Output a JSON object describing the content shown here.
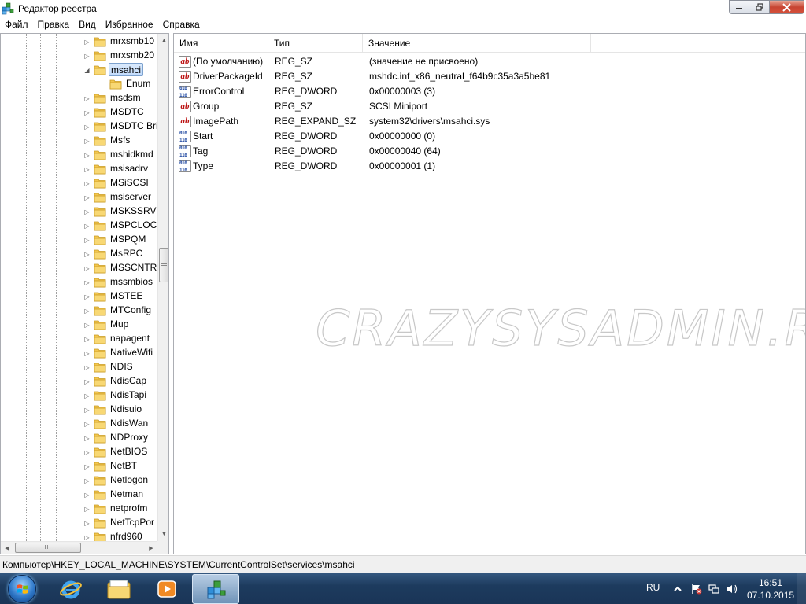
{
  "window": {
    "title": "Редактор реестра"
  },
  "menu": [
    "Файл",
    "Правка",
    "Вид",
    "Избранное",
    "Справка"
  ],
  "tree": {
    "items": [
      {
        "label": "mrxsmb10",
        "expander": "▷"
      },
      {
        "label": "mrxsmb20",
        "expander": "▷"
      },
      {
        "label": "msahci",
        "expander": "◢",
        "selected": true
      },
      {
        "label": "Enum",
        "expander": "",
        "child": true
      },
      {
        "label": "msdsm",
        "expander": "▷"
      },
      {
        "label": "MSDTC",
        "expander": "▷"
      },
      {
        "label": "MSDTC Bri",
        "expander": "▷"
      },
      {
        "label": "Msfs",
        "expander": "▷"
      },
      {
        "label": "mshidkmd",
        "expander": "▷"
      },
      {
        "label": "msisadrv",
        "expander": "▷"
      },
      {
        "label": "MSiSCSI",
        "expander": "▷"
      },
      {
        "label": "msiserver",
        "expander": "▷"
      },
      {
        "label": "MSKSSRV",
        "expander": "▷"
      },
      {
        "label": "MSPCLOCI",
        "expander": "▷"
      },
      {
        "label": "MSPQM",
        "expander": "▷"
      },
      {
        "label": "MsRPC",
        "expander": "▷"
      },
      {
        "label": "MSSCNTRS",
        "expander": "▷"
      },
      {
        "label": "mssmbios",
        "expander": "▷"
      },
      {
        "label": "MSTEE",
        "expander": "▷"
      },
      {
        "label": "MTConfig",
        "expander": "▷"
      },
      {
        "label": "Mup",
        "expander": "▷"
      },
      {
        "label": "napagent",
        "expander": "▷"
      },
      {
        "label": "NativeWifi",
        "expander": "▷"
      },
      {
        "label": "NDIS",
        "expander": "▷"
      },
      {
        "label": "NdisCap",
        "expander": "▷"
      },
      {
        "label": "NdisTapi",
        "expander": "▷"
      },
      {
        "label": "Ndisuio",
        "expander": "▷"
      },
      {
        "label": "NdisWan",
        "expander": "▷"
      },
      {
        "label": "NDProxy",
        "expander": "▷"
      },
      {
        "label": "NetBIOS",
        "expander": "▷"
      },
      {
        "label": "NetBT",
        "expander": "▷"
      },
      {
        "label": "Netlogon",
        "expander": "▷"
      },
      {
        "label": "Netman",
        "expander": "▷"
      },
      {
        "label": "netprofm",
        "expander": "▷"
      },
      {
        "label": "NetTcpPor",
        "expander": "▷"
      },
      {
        "label": "nfrd960",
        "expander": "▷"
      }
    ],
    "hscroll_grip": "III"
  },
  "list": {
    "columns": [
      "Имя",
      "Тип",
      "Значение"
    ],
    "rows": [
      {
        "icon": "string-value-icon",
        "icon_text": "ab",
        "name": "(По умолчанию)",
        "type": "REG_SZ",
        "value": "(значение не присвоено)"
      },
      {
        "icon": "string-value-icon",
        "icon_text": "ab",
        "name": "DriverPackageId",
        "type": "REG_SZ",
        "value": "mshdc.inf_x86_neutral_f64b9c35a3a5be81"
      },
      {
        "icon": "dword-value-icon",
        "icon_text": "010 110",
        "name": "ErrorControl",
        "type": "REG_DWORD",
        "value": "0x00000003 (3)"
      },
      {
        "icon": "string-value-icon",
        "icon_text": "ab",
        "name": "Group",
        "type": "REG_SZ",
        "value": "SCSI Miniport"
      },
      {
        "icon": "string-value-icon",
        "icon_text": "ab",
        "name": "ImagePath",
        "type": "REG_EXPAND_SZ",
        "value": "system32\\drivers\\msahci.sys"
      },
      {
        "icon": "dword-value-icon",
        "icon_text": "010 110",
        "name": "Start",
        "type": "REG_DWORD",
        "value": "0x00000000 (0)"
      },
      {
        "icon": "dword-value-icon",
        "icon_text": "010 110",
        "name": "Tag",
        "type": "REG_DWORD",
        "value": "0x00000040 (64)"
      },
      {
        "icon": "dword-value-icon",
        "icon_text": "010 110",
        "name": "Type",
        "type": "REG_DWORD",
        "value": "0x00000001 (1)"
      }
    ]
  },
  "watermark": "CRAZYSYSADMIN.RU",
  "status": {
    "path": "Компьютер\\HKEY_LOCAL_MACHINE\\SYSTEM\\CurrentControlSet\\services\\msahci"
  },
  "taskbar": {
    "apps": [
      "internet-explorer-icon",
      "explorer-icon",
      "media-player-icon",
      "regedit-icon"
    ],
    "tray": {
      "lang": "RU",
      "time": "16:51",
      "date": "07.10.2015"
    }
  },
  "colors": {
    "selection": "#c1dbfc",
    "taskbar": "#1d3b5e",
    "folder": "#f3c64f"
  }
}
